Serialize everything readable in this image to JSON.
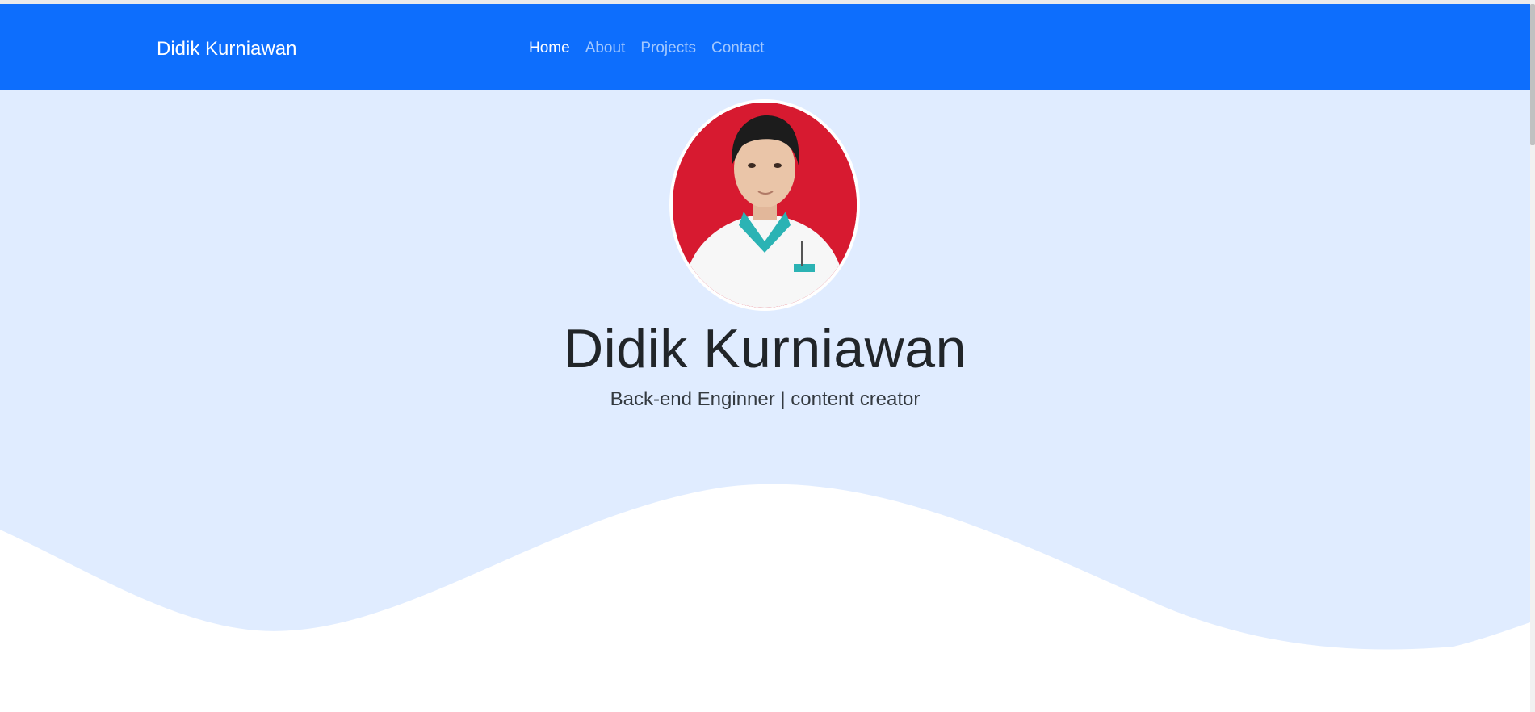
{
  "navbar": {
    "brand": "Didik Kurniawan",
    "links": [
      {
        "label": "Home",
        "active": true
      },
      {
        "label": "About",
        "active": false
      },
      {
        "label": "Projects",
        "active": false
      },
      {
        "label": "Contact",
        "active": false
      }
    ]
  },
  "hero": {
    "title": "Didik Kurniawan",
    "subtitle": "Back-end Enginner | content creator",
    "avatar_icon": "profile-photo"
  },
  "colors": {
    "navbar_bg": "#0d6efd",
    "hero_bg": "#e0ecff",
    "avatar_bg": "#d71a30"
  }
}
